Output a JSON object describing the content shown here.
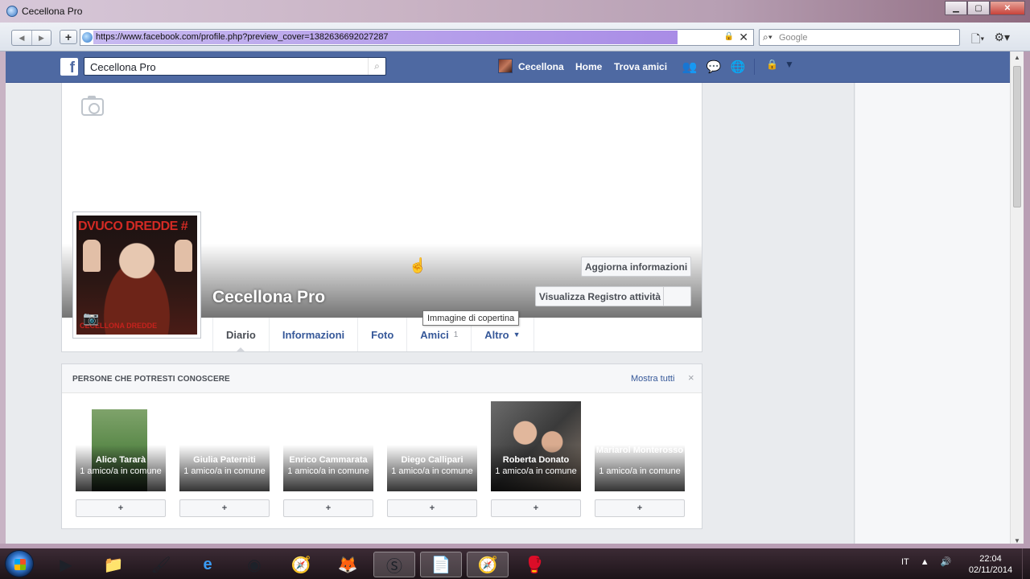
{
  "window": {
    "title": "Cecellona Pro",
    "minimize": "▁",
    "maximize": "▢",
    "close": "✕"
  },
  "browser": {
    "back": "◀",
    "forward": "▶",
    "new_tab": "+",
    "url": "https://www.facebook.com/profile.php?preview_cover=1382636692027287",
    "search_placeholder": "Google",
    "page_menu_icon": "page-icon",
    "tools_icon": "gear-icon"
  },
  "fb_header": {
    "logo": "f",
    "search_value": "Cecellona Pro",
    "user_name": "Cecellona",
    "home": "Home",
    "find_friends": "Trova amici"
  },
  "profile": {
    "name": "Cecellona Pro",
    "pic_text_top": "DVUCO DREDDE #",
    "pic_text_bottom": "CECELLONA DREDDE",
    "update_info": "Aggiorna informazioni",
    "activity_log": "Visualizza Registro attività",
    "cover_tooltip": "Immagine di copertina",
    "tabs": [
      {
        "label": "Diario",
        "count": ""
      },
      {
        "label": "Informazioni",
        "count": ""
      },
      {
        "label": "Foto",
        "count": ""
      },
      {
        "label": "Amici",
        "count": "1"
      },
      {
        "label": "Altro",
        "count": ""
      }
    ]
  },
  "pymk": {
    "title": "PERSONE CHE POTRESTI CONOSCERE",
    "show_all": "Mostra tutti",
    "close": "×",
    "add_label": "+",
    "people": [
      {
        "name": "Alice Tararà",
        "mutual": "1 amico/a in comune"
      },
      {
        "name": "Giulia Paterniti",
        "mutual": "1 amico/a in comune"
      },
      {
        "name": "Enrico Cammarata",
        "mutual": "1 amico/a in comune"
      },
      {
        "name": "Diego Callipari",
        "mutual": "1 amico/a in comune"
      },
      {
        "name": "Roberta Donato",
        "mutual": "1 amico/a in comune"
      },
      {
        "name": "Mariarol Monterosso",
        "mutual": "1 amico/a in comune"
      }
    ]
  },
  "taskbar": {
    "lang": "IT",
    "time": "22:04",
    "date": "02/11/2014"
  },
  "colors": {
    "fb_blue": "#4e69a2",
    "link": "#365899"
  }
}
